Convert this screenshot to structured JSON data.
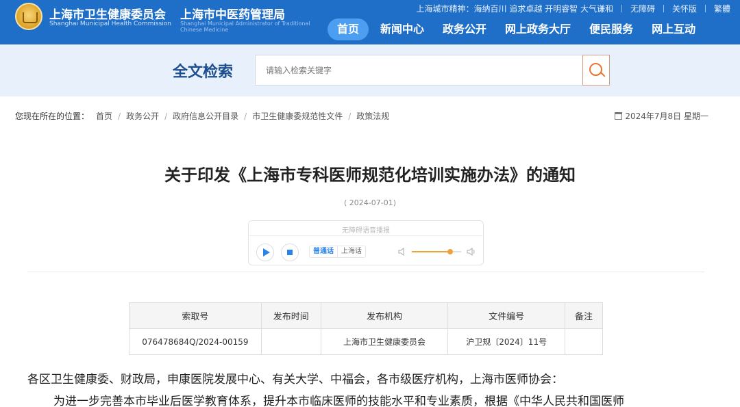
{
  "header": {
    "org_name_cn": "上海市卫生健康委员会",
    "org_name_en": "Shanghai Municipal Health Commission",
    "org2_name_cn": "上海市中医药管理局",
    "org2_name_en": "Shanghai Municipal Administrator of Traditional Chinese Medicine",
    "city_spirit": "上海城市精神：海纳百川 追求卓越 开明睿智 大气谦和",
    "top_links": [
      "无障碍",
      "关怀版",
      "繁體"
    ],
    "nav": [
      "首页",
      "新闻中心",
      "政务公开",
      "网上政务大厅",
      "便民服务",
      "网上互动"
    ],
    "nav_active_index": 0
  },
  "search": {
    "title": "全文检索",
    "placeholder": "请输入检索关键字"
  },
  "breadcrumb": {
    "lead": "您现在所在的位置：",
    "items": [
      "首页",
      "政务公开",
      "政府信息公开目录",
      "市卫生健康委规范性文件",
      "政策法规"
    ],
    "date": "2024年7月8日 星期一"
  },
  "article": {
    "title": "关于印发《上海市专科医师规范化培训实施办法》的通知",
    "pub_date": "( 2024-07-01)",
    "player": {
      "title": "无障碍语音播报",
      "lang_on": "普通话",
      "lang_off": "上海话",
      "volume": 0.78
    },
    "table": {
      "headers": [
        "索取号",
        "发布时间",
        "发布机构",
        "文件编号",
        "备注"
      ],
      "row": [
        "076478684Q/2024-00159",
        "",
        "上海市卫生健康委员会",
        "沪卫规〔2024〕11号",
        ""
      ]
    },
    "body_line1": "各区卫生健康委、财政局，申康医院发展中心、有关大学、中福会，各市级医疗机构，上海市医师协会：",
    "body_line2": "为进一步完善本市毕业后医学教育体系，提升本市临床医师的技能水平和专业素质，根据《中华人民共和国医师"
  }
}
